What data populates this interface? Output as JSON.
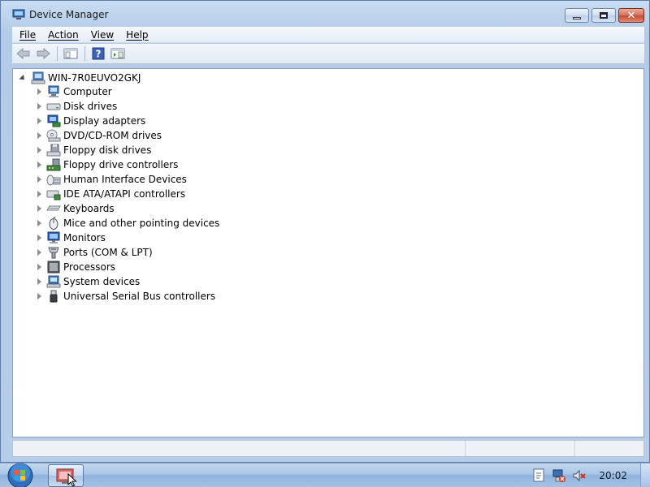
{
  "window": {
    "title": "Device Manager",
    "caption_buttons": [
      "minimize",
      "maximize",
      "close"
    ]
  },
  "menu": {
    "items": [
      "File",
      "Action",
      "View",
      "Help"
    ]
  },
  "toolbar": {
    "icons": [
      "back-arrow-icon",
      "forward-arrow-icon",
      "show-hide-console-tree-icon",
      "help-icon",
      "properties-icon"
    ]
  },
  "tree": {
    "root": "WIN-7R0EUVO2GKJ",
    "categories": [
      {
        "label": "Computer",
        "icon": "computer-icon"
      },
      {
        "label": "Disk drives",
        "icon": "disk-drive-icon"
      },
      {
        "label": "Display adapters",
        "icon": "display-adapter-icon"
      },
      {
        "label": "DVD/CD-ROM drives",
        "icon": "dvd-drive-icon"
      },
      {
        "label": "Floppy disk drives",
        "icon": "floppy-disk-icon"
      },
      {
        "label": "Floppy drive controllers",
        "icon": "floppy-controller-icon"
      },
      {
        "label": "Human Interface Devices",
        "icon": "hid-icon"
      },
      {
        "label": "IDE ATA/ATAPI controllers",
        "icon": "ide-controller-icon"
      },
      {
        "label": "Keyboards",
        "icon": "keyboard-icon"
      },
      {
        "label": "Mice and other pointing devices",
        "icon": "mouse-icon"
      },
      {
        "label": "Monitors",
        "icon": "monitor-icon"
      },
      {
        "label": "Ports (COM & LPT)",
        "icon": "port-icon"
      },
      {
        "label": "Processors",
        "icon": "processor-icon"
      },
      {
        "label": "System devices",
        "icon": "system-device-icon"
      },
      {
        "label": "Universal Serial Bus controllers",
        "icon": "usb-icon"
      }
    ]
  },
  "taskbar": {
    "clock": "20:02",
    "tray_icons": [
      "action-center-icon",
      "network-disconnected-icon",
      "volume-muted-icon"
    ]
  },
  "colors": {
    "title_bar": "#b9d1ea",
    "taskbar": "#9dbfe0",
    "close_button": "#c64a33",
    "tree_background": "#ffffff"
  }
}
